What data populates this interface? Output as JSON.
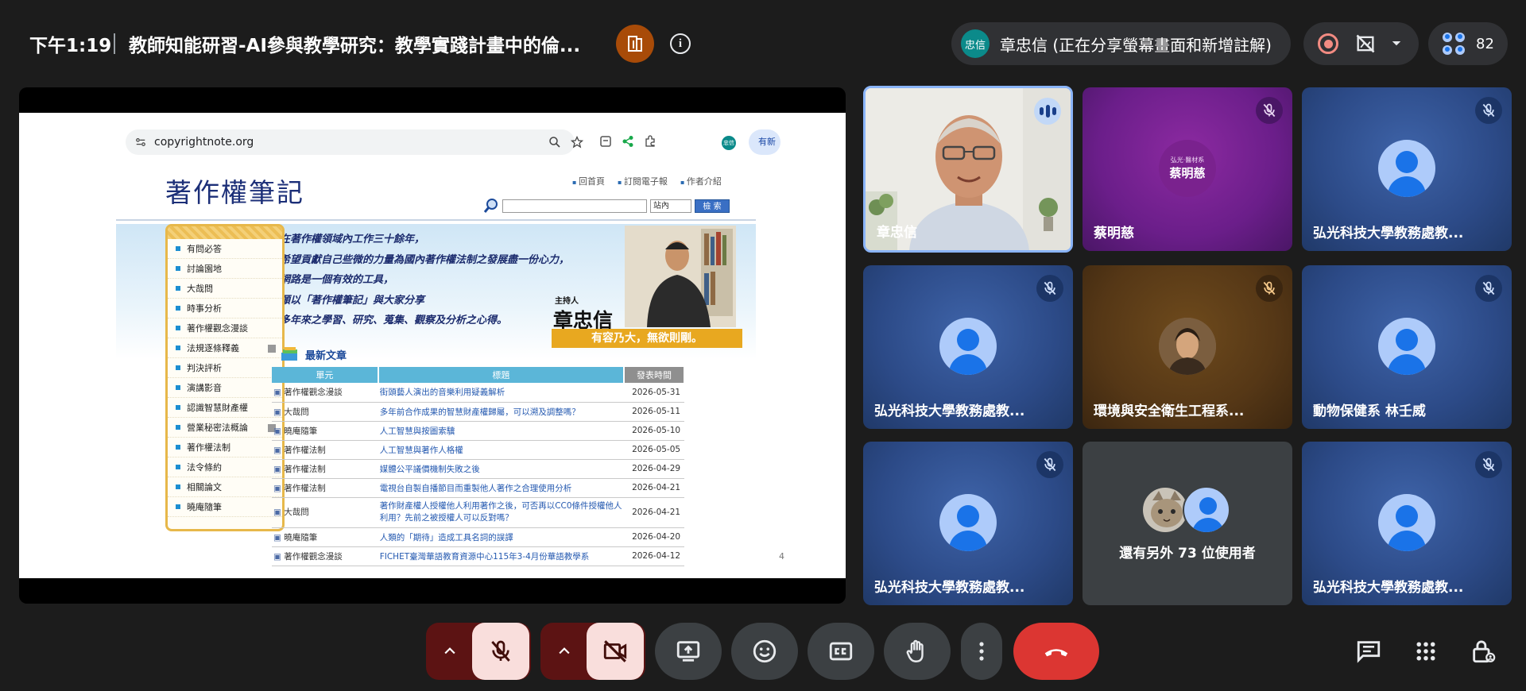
{
  "header": {
    "time": "下午1:19",
    "meeting_title": "教師知能研習-AI參與教學研究：教學實踐計畫中的倫...",
    "presenter_avatar": "忠信",
    "presenter_status": "章忠信 (正在分享螢幕畫面和新增註解)",
    "participant_count": "82",
    "info_icon": "i"
  },
  "browser": {
    "url": "copyrightnote.org",
    "ext_label": "有新",
    "ext_avatar": "忠信"
  },
  "site": {
    "logo": "著作權筆記",
    "nav": [
      "回首頁",
      "訂閱電子報",
      "作者介紹"
    ],
    "search_scope": "站內",
    "search_button": "檢 索",
    "slogan": [
      "在著作權領域內工作三十餘年，",
      "希望貢獻自己些微的力量為國內著作權法制之發展盡一份心力，",
      "網路是一個有效的工具，",
      "願以「著作權筆記」與大家分享",
      "多年來之學習、研究、蒐集、觀察及分析之心得。"
    ],
    "host_label": "主持人",
    "host_name": "章忠信",
    "motto": "有容乃大，無欲則剛。",
    "menu": [
      "有問必答",
      "討論園地",
      "大哉問",
      "時事分析",
      "著作權觀念漫談",
      "法規逐條釋義",
      "判決評析",
      "演講影音",
      "認識智慧財產權",
      "營業秘密法概論",
      "著作權法制",
      "法令條約",
      "相關論文",
      "曉庵隨筆"
    ],
    "news_heading": "最新文章",
    "table_headers": [
      "單元",
      "標題",
      "發表時間"
    ],
    "news": [
      {
        "cat": "著作權觀念漫談",
        "title": "街頭藝人演出的音樂利用疑義解析",
        "date": "2026-05-31"
      },
      {
        "cat": "大哉問",
        "title": "多年前合作成果的智慧財產權歸屬，可以溯及調整嗎？",
        "date": "2026-05-11"
      },
      {
        "cat": "曉庵隨筆",
        "title": "人工智慧與按圖索驥",
        "date": "2026-05-10"
      },
      {
        "cat": "著作權法制",
        "title": "人工智慧與著作人格權",
        "date": "2026-05-05"
      },
      {
        "cat": "著作權法制",
        "title": "媒體公平議價機制失敗之後",
        "date": "2026-04-29"
      },
      {
        "cat": "著作權法制",
        "title": "電視台自製自播節目而重製他人著作之合理使用分析",
        "date": "2026-04-21"
      },
      {
        "cat": "大哉問",
        "title": "著作財產權人授權他人利用著作之後，可否再以CC0條件授權他人利用？先前之被授權人可以反對嗎？",
        "date": "2026-04-21",
        "tall": true
      },
      {
        "cat": "曉庵隨筆",
        "title": "人類的「期待」造成工具名詞的誤譯",
        "date": "2026-04-20"
      },
      {
        "cat": "著作權觀念漫談",
        "title": "FICHET臺灣華語教育資源中心115年3-4月份華語教學系",
        "date": "2026-04-12"
      }
    ],
    "page_number": "4"
  },
  "participants": [
    {
      "name": "章忠信",
      "type": "video",
      "speaking": true
    },
    {
      "name": "蔡明慈",
      "type": "purple",
      "avatar_sub": "弘光‧醫材系",
      "avatar_main": "蔡明慈",
      "muted": true
    },
    {
      "name": "弘光科技大學教務處教...",
      "type": "blue",
      "muted": true
    },
    {
      "name": "弘光科技大學教務處教...",
      "type": "blue",
      "muted": true
    },
    {
      "name": "環境與安全衛生工程系...",
      "type": "brown",
      "muted": true
    },
    {
      "name": "動物保健系 林壬威",
      "type": "blue",
      "muted": true
    },
    {
      "name": "弘光科技大學教務處教...",
      "type": "blue",
      "muted": true
    },
    {
      "name": "還有另外 73 位使用者",
      "type": "others"
    },
    {
      "name": "弘光科技大學教務處教...",
      "type": "blue",
      "muted": true
    }
  ],
  "colors": {
    "background": "#1c1c1c",
    "accent_blue": "#8ab4f8",
    "end_call": "#dc3632",
    "muted_control": "#f9dedc",
    "record": "#f28b82"
  },
  "controls": {
    "icons": [
      "chevron-up-icon",
      "mic-off-icon",
      "chevron-up-icon",
      "camera-off-icon",
      "present-screen-icon",
      "emoji-icon",
      "captions-icon",
      "raise-hand-icon",
      "more-options-icon",
      "end-call-icon"
    ],
    "corner_icons": [
      "chat-icon",
      "activities-icon",
      "host-controls-icon"
    ]
  }
}
